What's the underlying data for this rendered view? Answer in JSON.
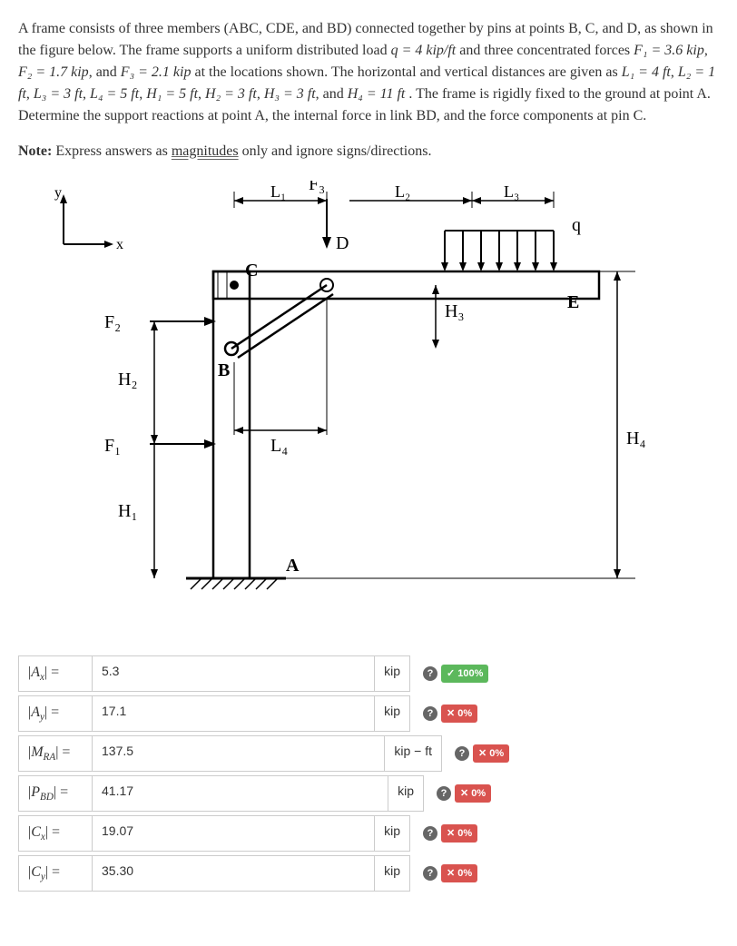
{
  "problem": {
    "intro": "A frame consists of three members (ABC, CDE, and BD) connected together by pins at points B, C, and D, as shown in the figure below. The frame supports a uniform distributed load ",
    "q_eq": "q = 4 kip/ft",
    "and_three": " and three concentrated forces ",
    "f1": "F₁ = 3.6 kip",
    "f2": "F₂ = 1.7 kip",
    "f3": "F₃ = 2.1 kip",
    "loc": " at the locations shown. The horizontal and vertical distances are given as ",
    "l1": "L₁ = 4 ft",
    "l2": "L₂ = 1 ft",
    "l3": "L₃ = 3 ft",
    "l4": "L₄ = 5 ft",
    "h1": "H₁ = 5 ft",
    "h2": "H₂ = 3 ft",
    "h3": "H₃ = 3 ft",
    "h4": "H₄ = 11 ft",
    "rest": ". The frame is rigidly fixed to the ground at point A. Determine the support reactions at point A, the internal force in link BD, and the force components at pin C."
  },
  "note": {
    "label": "Note:",
    "text1": " Express answers as ",
    "underlined": "magnitudes",
    "text2": " only and ignore signs/directions."
  },
  "figure": {
    "y": "y",
    "x": "x",
    "L1": "L₁",
    "L2": "L₂",
    "L3": "L₃",
    "L4": "L₄",
    "F1": "F₁",
    "F2": "F₂",
    "F3": "F₃",
    "H1": "H₁",
    "H2": "H₂",
    "H3": "H₃",
    "H4": "H₄",
    "q": "q",
    "A": "A",
    "B": "B",
    "C": "C",
    "D": "D",
    "E": "E"
  },
  "answers": [
    {
      "label": "|Aₓ| =",
      "value": "5.3",
      "unit": "kip",
      "status": "correct",
      "badge": "✓ 100%"
    },
    {
      "label": "|Aᵧ| =",
      "value": "17.1",
      "unit": "kip",
      "status": "wrong",
      "badge": "✕ 0%"
    },
    {
      "label": "|M_RA| =",
      "value": "137.5",
      "unit": "kip − ft",
      "status": "wrong",
      "badge": "✕ 0%"
    },
    {
      "label": "|P_BD| =",
      "value": "41.17",
      "unit": "kip",
      "status": "wrong",
      "badge": "✕ 0%"
    },
    {
      "label": "|Cₓ| =",
      "value": "19.07",
      "unit": "kip",
      "status": "wrong",
      "badge": "✕ 0%"
    },
    {
      "label": "|Cᵧ| =",
      "value": "35.30",
      "unit": "kip",
      "status": "wrong",
      "badge": "✕ 0%"
    }
  ],
  "widths": [
    430,
    430,
    465,
    445,
    430,
    430
  ]
}
